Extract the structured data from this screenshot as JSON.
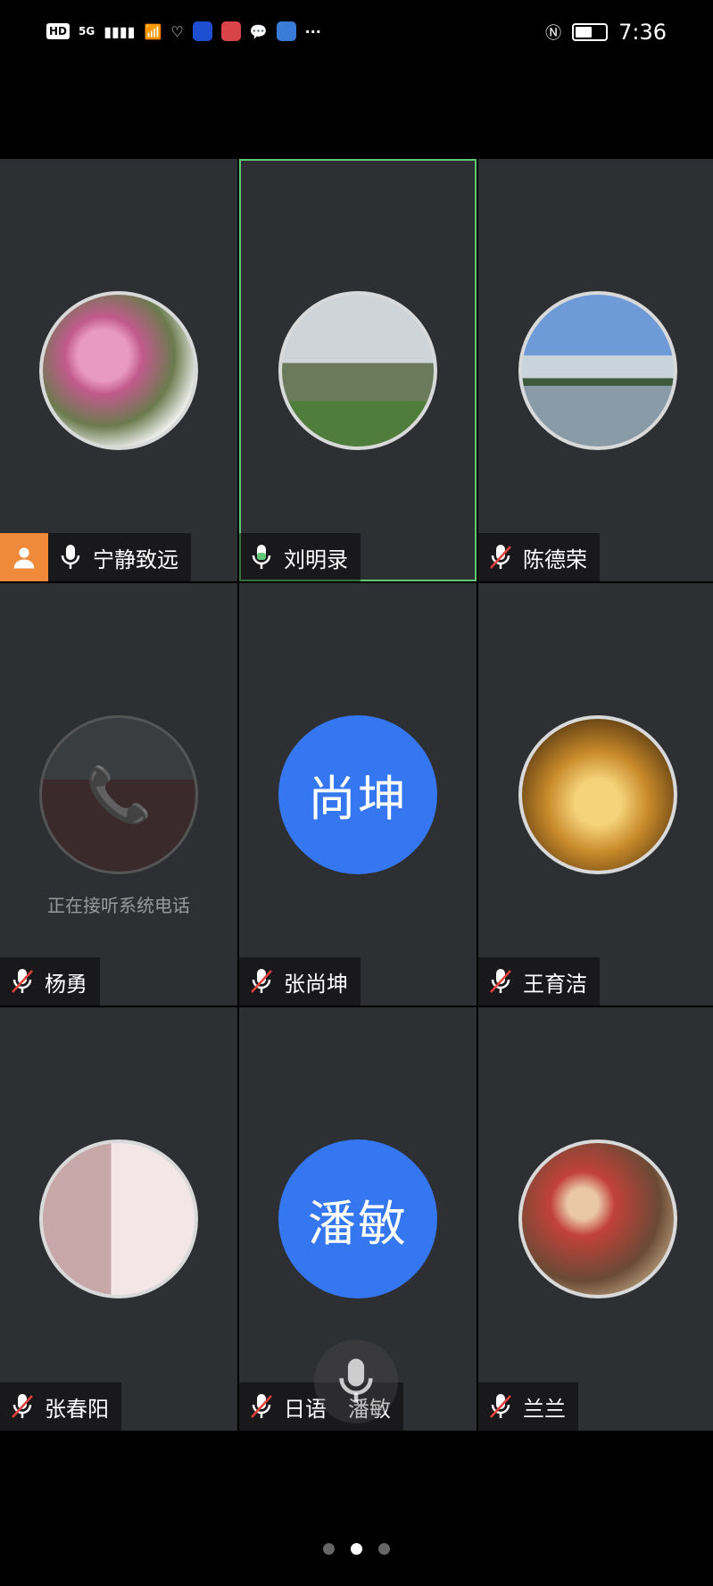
{
  "status_bar": {
    "hd": "HD",
    "network": "5G",
    "time": "7:36"
  },
  "tiles": [
    {
      "name": "宁静致远",
      "mic": "on",
      "host": true,
      "avatar": "photo-flowers",
      "active": false
    },
    {
      "name": "刘明录",
      "mic": "on",
      "host": false,
      "avatar": "photo-monument",
      "active": true
    },
    {
      "name": "陈德荣",
      "mic": "muted",
      "host": false,
      "avatar": "photo-lake-city",
      "active": false
    },
    {
      "name": "杨勇",
      "mic": "muted",
      "host": false,
      "avatar": "photo-field-phone",
      "active": false,
      "note": "正在接听系统电话"
    },
    {
      "name": "张尚坤",
      "mic": "muted",
      "host": false,
      "avatar_text": "尚坤",
      "active": false
    },
    {
      "name": "王育洁",
      "mic": "muted",
      "host": false,
      "avatar": "photo-golden-lotus",
      "active": false
    },
    {
      "name": "张春阳",
      "mic": "muted",
      "host": false,
      "avatar": "photo-child",
      "active": false
    },
    {
      "name": "日语　潘敏",
      "mic": "muted",
      "host": false,
      "avatar_text": "潘敏",
      "active": false
    },
    {
      "name": "兰兰",
      "mic": "muted",
      "host": false,
      "avatar": "photo-painting",
      "active": false
    }
  ],
  "pager": {
    "pages": 3,
    "current_index": 1
  },
  "colors": {
    "accent_blue": "#3477f0",
    "active_border": "#5fc874",
    "host_orange": "#f08a3b",
    "mute_red": "#e0413a"
  }
}
